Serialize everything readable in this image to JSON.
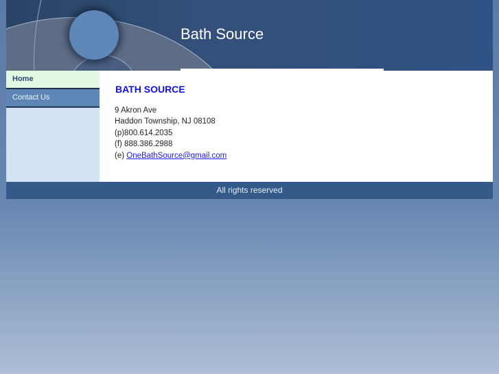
{
  "header": {
    "title": "Bath Source"
  },
  "nav": {
    "items": [
      {
        "label": "Home"
      },
      {
        "label": "Contact Us"
      }
    ]
  },
  "content": {
    "heading": "BATH SOURCE",
    "street": "9 Akron Ave",
    "city": "Haddon Township, NJ 08108",
    "phone": "(p)800.614.2035",
    "fax": "(f) 888.386.2988",
    "email_prefix": "(e)",
    "email": "OneBathSource@gmail.com"
  },
  "footer": {
    "text": "All rights reserved"
  },
  "colors": {
    "heading": "#1010ee",
    "footer": "#335a88",
    "nav_active": "#e3f7e3"
  }
}
